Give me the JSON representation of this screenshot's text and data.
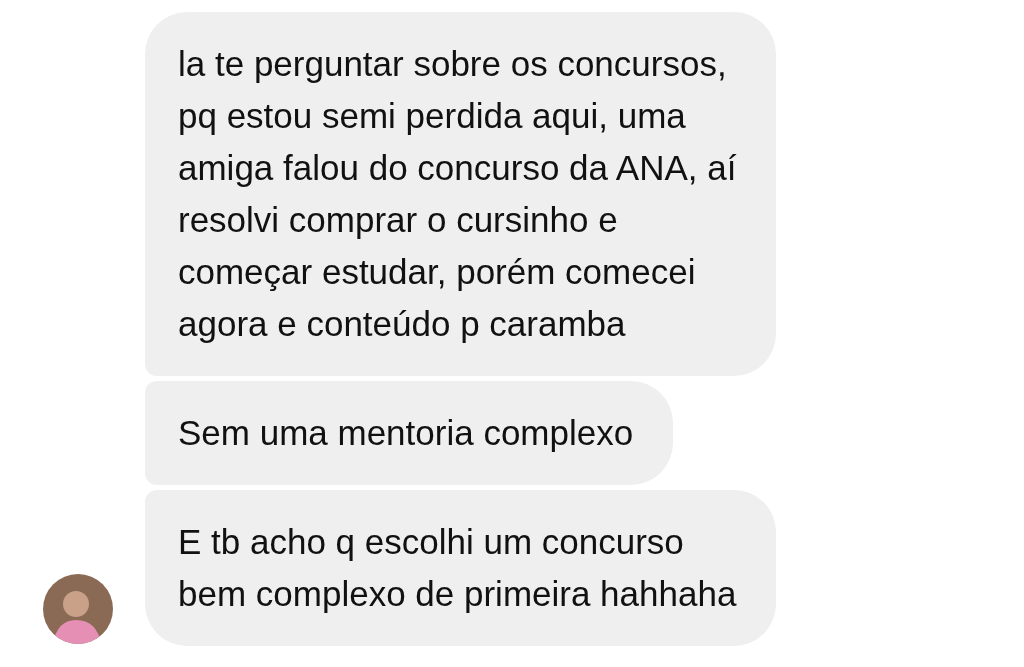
{
  "messages": [
    {
      "text": "la te perguntar sobre os concursos,\npq estou semi perdida aqui, uma\namiga falou do concurso da ANA, aí\nresolvi comprar o cursinho e\ncomeçar estudar, porém comecei\nagora e conteúdo p caramba"
    },
    {
      "text": "Sem uma mentoria complexo"
    },
    {
      "text": "E tb acho q escolhi um concurso\nbem complexo de primeira hahhaha"
    }
  ]
}
